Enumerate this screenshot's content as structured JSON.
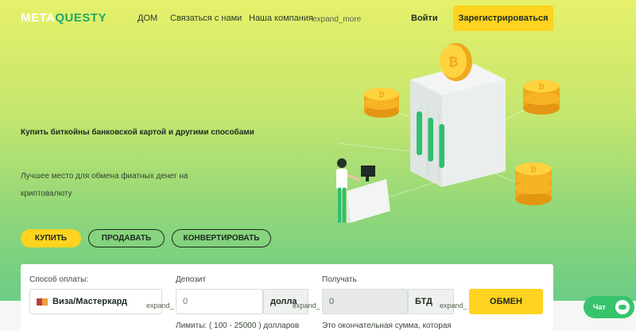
{
  "header": {
    "logo_main": "META",
    "logo_accent": "QUESTY",
    "nav": [
      "ДОМ",
      "Связаться с нами",
      "Наша компания"
    ],
    "nav_expand_icon": "expand_more",
    "login_label": "Войти",
    "register_label": "Зарегистрироваться"
  },
  "hero": {
    "title": "Купить биткойны банковской картой и другими способами",
    "subtitle": "Лучшее место для обмена фиатных денег на криптовалюту"
  },
  "tabs": {
    "buy": "КУПИТЬ",
    "sell": "ПРОДАВАТЬ",
    "convert": "КОНВЕРТИРОВАТЬ"
  },
  "form": {
    "payment_label": "Способ оплаты:",
    "payment_value": "Виза/Мастеркард",
    "payment_expand_icon": "expand_",
    "deposit_label": "Депозит",
    "deposit_placeholder": "0",
    "deposit_unit": "долла",
    "deposit_expand_icon": "expand_",
    "receive_label": "Получать",
    "receive_value": "0",
    "receive_unit": "БТД",
    "receive_expand_icon": "expand_",
    "exchange_label": "ОБМЕН",
    "limits_text": "Лимиты: ( 100 - 25000 ) долларов",
    "final_amount_text": "Это окончательная сумма, которая"
  },
  "chat": {
    "label": "Чат"
  },
  "colors": {
    "brand_yellow": "#ffd31f",
    "brand_green": "#1fa96a",
    "chat_green": "#37c46c"
  }
}
